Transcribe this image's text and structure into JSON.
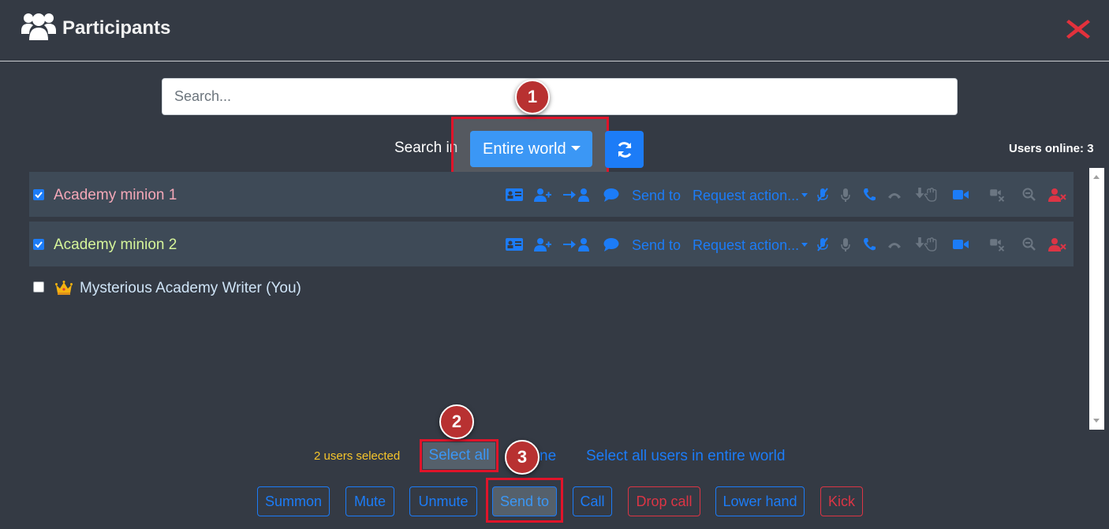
{
  "header": {
    "title": "Participants"
  },
  "search": {
    "placeholder": "Search...",
    "value": ""
  },
  "scope": {
    "label": "Search in",
    "selected": "Entire world"
  },
  "online": "Users online: 3",
  "users": [
    {
      "name": "Academy minion 1",
      "checked": true,
      "color": "#f5a8b8"
    },
    {
      "name": "Academy minion 2",
      "checked": true,
      "color": "#d6f59a"
    },
    {
      "name": "Mysterious Academy Writer (You)",
      "checked": false,
      "color": "#cfe4f7",
      "crown": "crown-icon"
    }
  ],
  "row_actions": {
    "send_to": "Send to",
    "request_action": "Request action..."
  },
  "selection": {
    "count_text": "2 users selected",
    "select_all": "Select all",
    "select_none": "ne",
    "select_world": "Select all users in entire world"
  },
  "bulk_actions": {
    "summon": "Summon",
    "mute": "Mute",
    "unmute": "Unmute",
    "send_to": "Send to",
    "call": "Call",
    "drop_call": "Drop call",
    "lower_hand": "Lower hand",
    "kick": "Kick"
  },
  "steps": [
    "1",
    "2",
    "3"
  ],
  "colors": {
    "accent": "#1c7cf7",
    "danger": "#dc3545",
    "highlight": "#e0142a",
    "selected_count": "#f6c52b",
    "background": "#343a44"
  }
}
